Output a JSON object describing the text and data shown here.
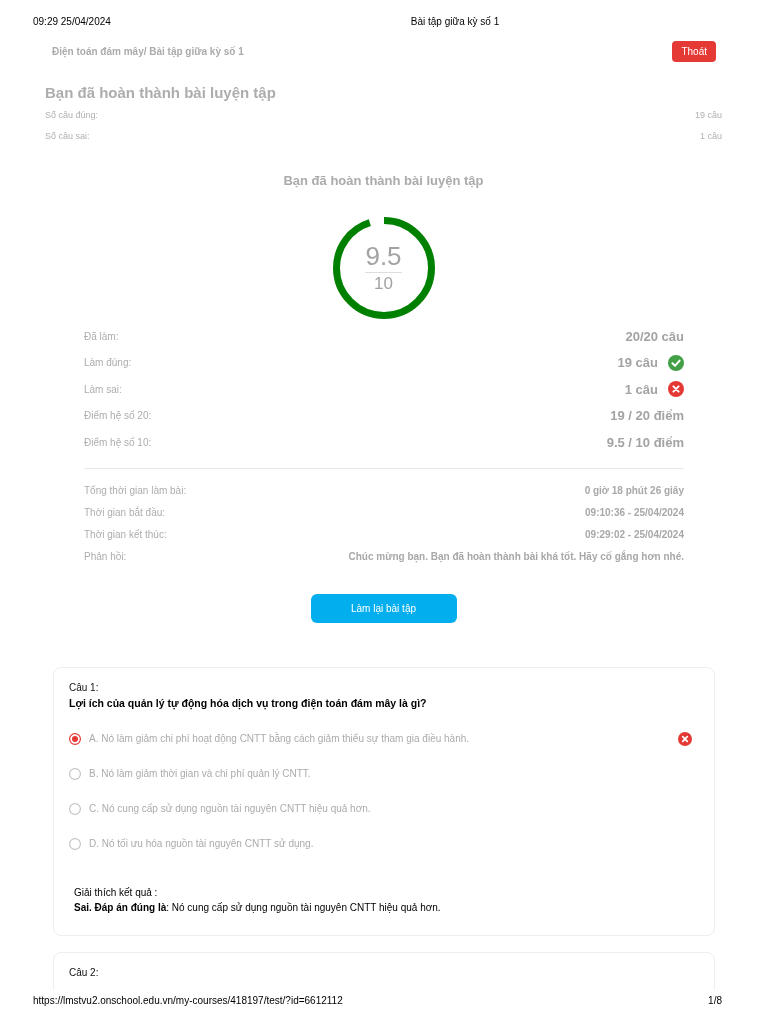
{
  "print_header": {
    "datetime": "09:29 25/04/2024",
    "title": "Bài tập giữa kỳ số 1"
  },
  "breadcrumb": "Điện toán đám mây/ Bài tập giữa kỳ số 1",
  "exit_button": "Thoát",
  "summary": {
    "title": "Bạn đã hoàn thành bài luyện tập",
    "rows": [
      {
        "label": "Số câu đúng:",
        "value": "19 câu"
      },
      {
        "label": "Số câu sai:",
        "value": "1 câu"
      }
    ]
  },
  "result": {
    "title": "Bạn đã hoàn thành bài luyện tập",
    "score": {
      "value": "9.5",
      "max": "10",
      "level": 0.95
    },
    "stats": [
      {
        "kind": "plain",
        "label": "Đã làm:",
        "value": "20/20 câu"
      },
      {
        "kind": "correct",
        "label": "Làm đúng:",
        "value": "19 câu"
      },
      {
        "kind": "wrong",
        "label": "Làm sai:",
        "value": "1 câu"
      },
      {
        "kind": "plain",
        "label": "Điểm hệ số 20:",
        "value": "19 / 20 điểm"
      },
      {
        "kind": "plain",
        "label": "Điểm hệ số 10:",
        "value": "9.5 / 10 điểm"
      }
    ],
    "times": [
      {
        "label": "Tổng thời gian làm bài:",
        "value": "0 giờ 18 phút 26 giây"
      },
      {
        "label": "Thời gian bắt đầu:",
        "value": "09:10:36 - 25/04/2024"
      },
      {
        "label": "Thời gian kết thúc:",
        "value": "09:29:02 - 25/04/2024"
      },
      {
        "label": "Phản hồi:",
        "value": "Chúc mừng bạn. Bạn đã hoàn thành bài khá tốt. Hãy cố gắng hơn nhé."
      }
    ],
    "retry_button": "Làm lại bài tập"
  },
  "questions": [
    {
      "number": "Câu 1:",
      "text": "Lợi ích của quản lý tự động hóa dịch vụ trong điện toán đám mây là gì?",
      "options": [
        {
          "label": "A. Nó làm giảm chi phí hoạt động CNTT bằng cách giảm thiểu sự tham gia điều hành.",
          "selected": true,
          "marked_wrong": true
        },
        {
          "label": "B. Nó làm giảm thời gian và chi phí quản lý CNTT.",
          "selected": false,
          "marked_wrong": false
        },
        {
          "label": "C. Nó cung cấp sử dụng nguồn tài nguyên CNTT hiệu quả hơn.",
          "selected": false,
          "marked_wrong": false
        },
        {
          "label": "D. Nó tối ưu hóa nguồn tài nguyên CNTT sử dụng.",
          "selected": false,
          "marked_wrong": false
        }
      ],
      "explanation": {
        "heading": "Giải thích kết quả :",
        "text": "**Sai. Đáp án đúng là**: Nó cung cấp sử dụng nguồn tài nguyên CNTT hiệu quả hơn."
      }
    },
    {
      "number": "Câu 2:"
    }
  ],
  "print_footer": {
    "url": "https://lmstvu2.onschool.edu.vn/my-courses/418197/test/?id=6612112",
    "page": "1/8"
  }
}
